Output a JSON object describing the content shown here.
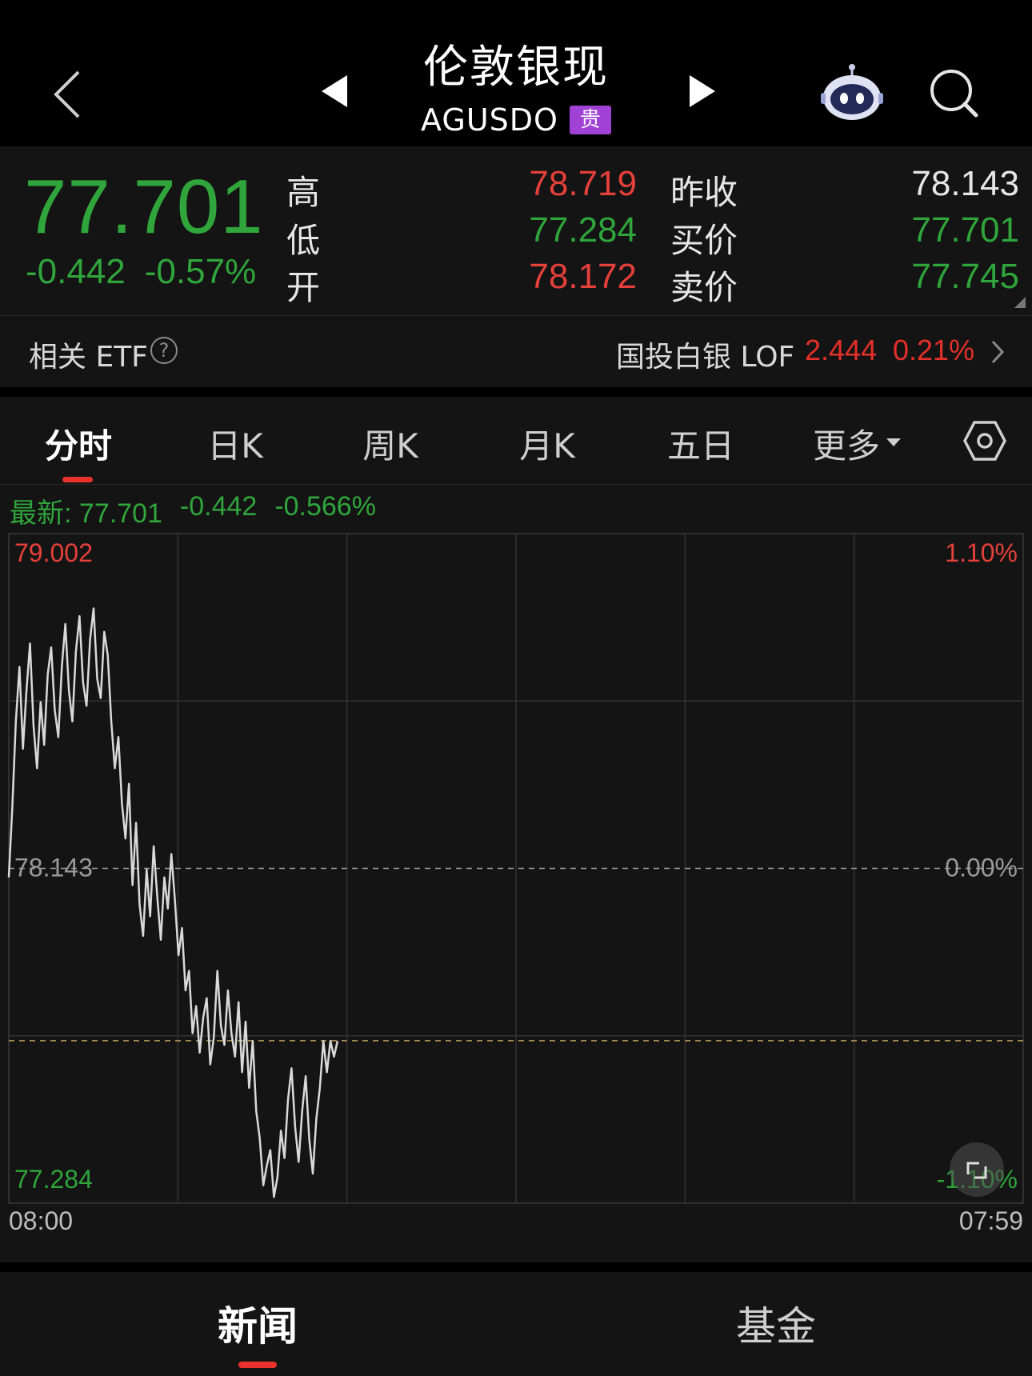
{
  "header": {
    "title": "伦敦银现",
    "symbol": "AGUSDO",
    "badge": "贵"
  },
  "quote": {
    "last": "77.701",
    "change": "-0.442",
    "change_pct": "-0.57%",
    "labels": {
      "high": "高",
      "low": "低",
      "open": "开",
      "prev_close": "昨收",
      "bid": "买价",
      "ask": "卖价"
    },
    "high": "78.719",
    "low": "77.284",
    "open": "78.172",
    "prev_close": "78.143",
    "bid": "77.701",
    "ask": "77.745"
  },
  "etf": {
    "label": "相关 ETF",
    "help": "?",
    "name": "国投白银 LOF",
    "price": "2.444",
    "change_pct": "0.21%"
  },
  "tabs": [
    {
      "label": "分时",
      "active": true
    },
    {
      "label": "日K",
      "active": false
    },
    {
      "label": "周K",
      "active": false
    },
    {
      "label": "月K",
      "active": false
    },
    {
      "label": "五日",
      "active": false
    },
    {
      "label": "更多",
      "active": false
    }
  ],
  "latest": {
    "prefix": "最新:",
    "price": "77.701",
    "change": "-0.442",
    "change_pct": "-0.566%"
  },
  "colors": {
    "up": "#e5403a",
    "down": "#2fa53b",
    "line": "#d9d9d9",
    "accent": "#e8322b"
  },
  "chart_data": {
    "type": "line",
    "x_start_label": "08:00",
    "x_end_label": "07:59",
    "y_max_label": "79.002",
    "y_mid_label": "78.143",
    "y_min_label": "77.284",
    "pct_max_label": "1.10%",
    "pct_mid_label": "0.00%",
    "pct_min_label": "-1.10%",
    "ylim": [
      77.284,
      79.002
    ],
    "prev_close": 78.143,
    "reference_line": 77.701,
    "total_points": 288,
    "grid_columns": 6,
    "grid_rows": 4,
    "values": [
      78.12,
      78.3,
      78.52,
      78.66,
      78.45,
      78.6,
      78.72,
      78.51,
      78.4,
      78.57,
      78.46,
      78.64,
      78.71,
      78.55,
      78.48,
      78.66,
      78.77,
      78.6,
      78.52,
      78.7,
      78.79,
      78.62,
      78.56,
      78.73,
      78.81,
      78.63,
      78.58,
      78.75,
      78.69,
      78.52,
      78.4,
      78.48,
      78.31,
      78.22,
      78.36,
      78.1,
      78.26,
      78.05,
      77.97,
      78.14,
      78.02,
      78.2,
      78.07,
      77.96,
      78.12,
      78.04,
      78.18,
      78.06,
      77.92,
      77.99,
      77.83,
      77.88,
      77.72,
      77.79,
      77.67,
      77.76,
      77.81,
      77.64,
      77.71,
      77.88,
      77.74,
      77.69,
      77.83,
      77.72,
      77.66,
      77.8,
      77.62,
      77.75,
      77.58,
      77.7,
      77.52,
      77.45,
      77.33,
      77.38,
      77.42,
      77.3,
      77.35,
      77.47,
      77.4,
      77.55,
      77.63,
      77.48,
      77.39,
      77.52,
      77.61,
      77.45,
      77.36,
      77.5,
      77.58,
      77.7,
      77.62,
      77.7,
      77.66,
      77.7
    ]
  }
}
